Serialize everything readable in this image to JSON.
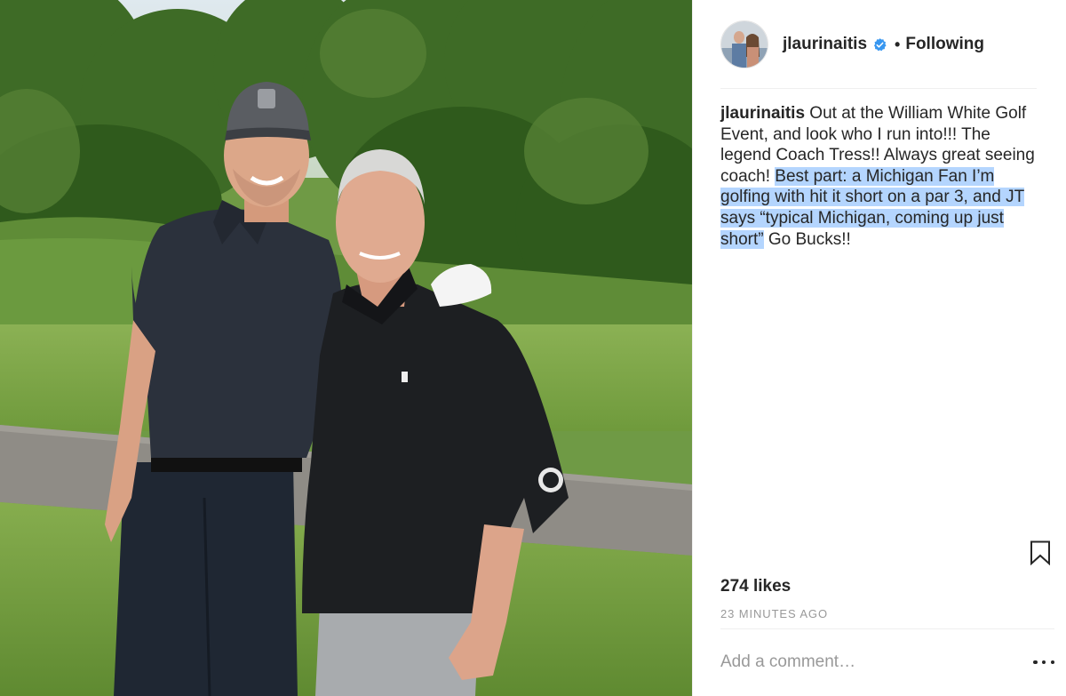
{
  "post": {
    "photo_alt": "Two men posing on a golf course",
    "author": {
      "username": "jlaurinaitis",
      "verified": true,
      "follow_label": "Following",
      "separator": "•"
    },
    "caption": {
      "username": "jlaurinaitis",
      "text_plain": " Out at the William White Golf Event, and look who I run into!!! The legend Coach Tress!! Always great seeing coach! ",
      "text_highlighted": "Best part: a Michigan Fan I’m golfing with hit it short on a par 3, and JT says “typical Michigan, coming up just short”",
      "text_after": " Go Bucks!!"
    },
    "likes_label": "274 likes",
    "timestamp": "23 MINUTES AGO",
    "comment": {
      "placeholder": "Add a comment…",
      "value": ""
    },
    "icons": {
      "verified": "verified-badge-icon",
      "save": "bookmark-icon",
      "more": "more-options-icon"
    },
    "colors": {
      "verified_blue": "#3897f0",
      "highlight": "#b4d5fe",
      "muted_text": "#999999"
    }
  }
}
